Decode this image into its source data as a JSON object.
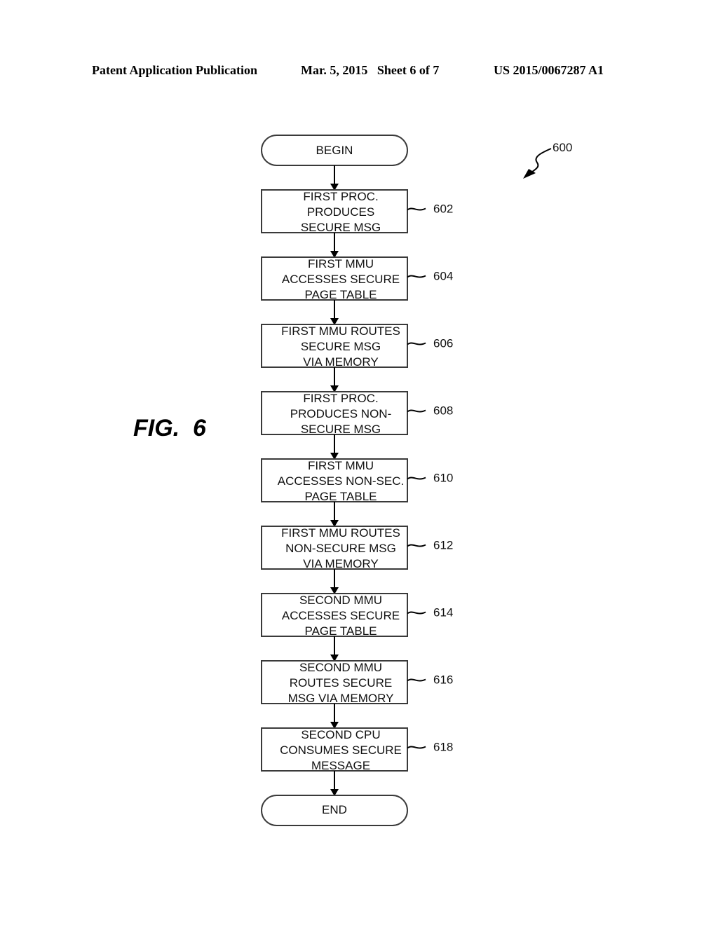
{
  "header": {
    "left": "Patent Application Publication",
    "middle": "Mar. 5, 2015   Sheet 6 of 7",
    "right": "US 2015/0067287 A1"
  },
  "figure": {
    "label": "FIG.  6",
    "reference": "600"
  },
  "flowchart": {
    "start": "BEGIN",
    "end": "END",
    "steps": [
      {
        "ref": "602",
        "lines": [
          "FIRST PROC.",
          "PRODUCES",
          "SECURE MSG"
        ]
      },
      {
        "ref": "604",
        "lines": [
          "FIRST MMU",
          "ACCESSES SECURE",
          "PAGE TABLE"
        ]
      },
      {
        "ref": "606",
        "lines": [
          "FIRST MMU ROUTES",
          "SECURE MSG",
          "VIA MEMORY"
        ]
      },
      {
        "ref": "608",
        "lines": [
          "FIRST PROC.",
          "PRODUCES NON-",
          "SECURE MSG"
        ]
      },
      {
        "ref": "610",
        "lines": [
          "FIRST MMU",
          "ACCESSES NON-SEC.",
          "PAGE TABLE"
        ]
      },
      {
        "ref": "612",
        "lines": [
          "FIRST MMU ROUTES",
          "NON-SECURE MSG",
          "VIA MEMORY"
        ]
      },
      {
        "ref": "614",
        "lines": [
          "SECOND MMU",
          "ACCESSES SECURE",
          "PAGE TABLE"
        ]
      },
      {
        "ref": "616",
        "lines": [
          "SECOND MMU",
          "ROUTES SECURE",
          "MSG VIA MEMORY"
        ]
      },
      {
        "ref": "618",
        "lines": [
          "SECOND CPU",
          "CONSUMES SECURE",
          "MESSAGE"
        ]
      }
    ]
  }
}
